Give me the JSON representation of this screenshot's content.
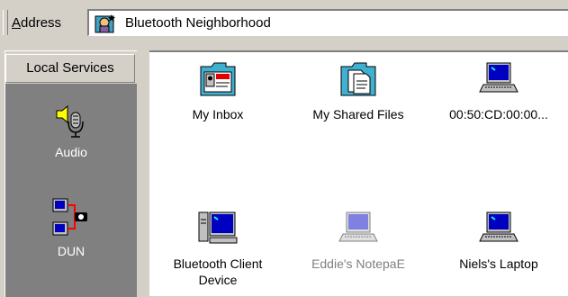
{
  "address_bar": {
    "label_prefix": "",
    "label_accel": "A",
    "label_rest": "ddress",
    "value": "Bluetooth Neighborhood",
    "icon": "bluetooth-neighborhood-icon"
  },
  "left_pane": {
    "header": "Local Services",
    "services": [
      {
        "label": "Audio",
        "icon": "headset-microphone-icon"
      },
      {
        "label": "DUN",
        "icon": "dial-up-network-icon"
      }
    ]
  },
  "items": [
    {
      "label": "My Inbox",
      "icon": "inbox-card-folder-icon"
    },
    {
      "label": "My Shared Files",
      "icon": "shared-files-folder-icon"
    },
    {
      "label": "00:50:CD:00:00...",
      "icon": "laptop-icon"
    },
    {
      "label": "Bluetooth Client Device",
      "icon": "desktop-computer-icon"
    },
    {
      "label": "Eddie's NotepaE",
      "icon": "laptop-dimmed-icon"
    },
    {
      "label": "Niels's Laptop",
      "icon": "laptop-icon"
    }
  ],
  "colors": {
    "panel_gray": "#d4d0c8",
    "dark_gray": "#808080",
    "dim_text": "#808080",
    "screen_blue": "#0000c0"
  }
}
